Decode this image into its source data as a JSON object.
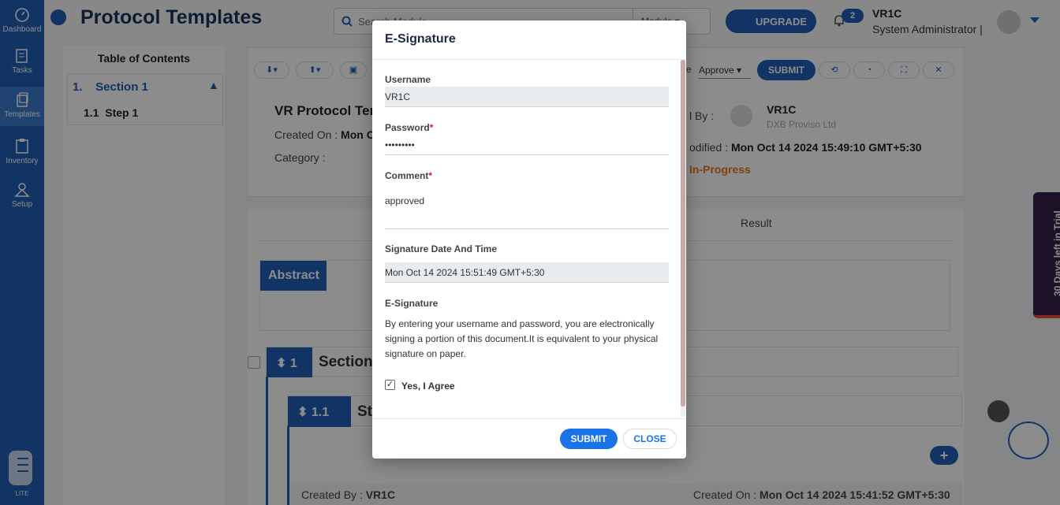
{
  "sidebar": {
    "items": [
      {
        "label": "Dashboard",
        "icon": "dashboard-icon"
      },
      {
        "label": "Tasks",
        "icon": "tasks-icon"
      },
      {
        "label": "Templates",
        "icon": "templates-icon"
      },
      {
        "label": "Inventory",
        "icon": "inventory-icon"
      },
      {
        "label": "Setup",
        "icon": "setup-icon"
      }
    ],
    "logo_label": "LITE"
  },
  "header": {
    "title": "Protocol Templates",
    "search_placeholder": "Search Module",
    "module_label": "Module",
    "upgrade_label": "UPGRADE",
    "notification_count": "2",
    "user_name": "VR1C",
    "user_role": "System Administrator |"
  },
  "toc": {
    "title": "Table of Contents",
    "section_label": "1.    Section 1",
    "step_label": "1.1  Step 1"
  },
  "document": {
    "title": "VR Protocol Ter",
    "created_on_label": "Created On :",
    "created_on_value": "Mon C",
    "category_label": "Category :",
    "by_label": "l By :",
    "owner_name": "VR1C",
    "owner_org": "DXB Proviso Ltd",
    "modified_label": "odified :",
    "modified_value": "Mon Oct 14 2024 15:49:10 GMT+5:30",
    "status": "In-Progress",
    "action_prefix": "e",
    "action_select": "Approve",
    "submit_label": "SUBMIT"
  },
  "content": {
    "result_tab": "Result",
    "abstract_label": "Abstract",
    "section_num": "1",
    "section_title": "Section",
    "step_num": "1.1",
    "step_title": "St",
    "footer_created_by_label": "Created By :",
    "footer_created_by": "VR1C",
    "footer_created_on_label": "Created On :",
    "footer_created_on": "Mon Oct 14 2024 15:41:52 GMT+5:30"
  },
  "trial": {
    "label": "30 Days left in Trial"
  },
  "modal": {
    "title": "E-Signature",
    "username_label": "Username",
    "username_value": "VR1C",
    "password_label": "Password",
    "password_value": "•••••••••",
    "comment_label": "Comment",
    "comment_value": "approved",
    "date_label": "Signature Date And Time",
    "date_value": "Mon Oct 14 2024 15:51:49 GMT+5:30",
    "esig_label": "E-Signature",
    "esig_text": "By entering your username and password, you are electronically signing a portion of this document.It is equivalent to your physical signature on paper.",
    "agree_label": "Yes, I Agree",
    "agree_checked": "✓",
    "required_mark": "*",
    "submit_label": "SUBMIT",
    "close_label": "CLOSE"
  },
  "colors": {
    "primary": "#1f5fb8",
    "status": "#e07a12",
    "required": "#d0202a"
  }
}
